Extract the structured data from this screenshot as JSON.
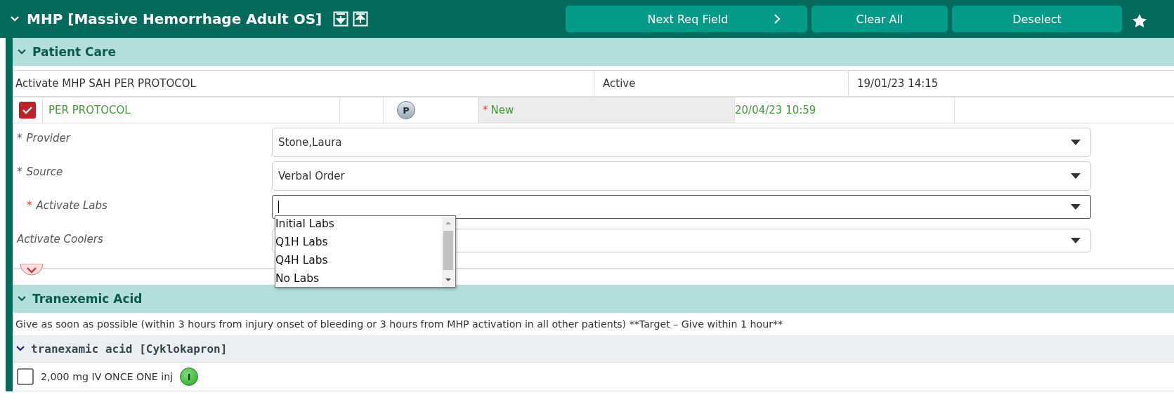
{
  "order_set": {
    "title": "MHP [Massive Hemorrhage Adult OS]",
    "expanded": true,
    "buttons": [
      {
        "label": "Next Req Field",
        "kind": "next"
      },
      {
        "label": "Clear All",
        "kind": "plain"
      },
      {
        "label": "Deselect",
        "kind": "plain"
      }
    ]
  },
  "patient_care": {
    "title": "Patient Care",
    "expanded": true,
    "active_order": {
      "cells": [
        "Activate MHP SAH PER PROTOCOL",
        "Active",
        "19/01/23 14:15"
      ]
    },
    "new_order": {
      "checked": true,
      "name": "PER PROTOCOL",
      "badge": "P",
      "status_marker": "*",
      "status": "New",
      "date": "20/04/23 10:59"
    },
    "details": [
      {
        "marker": "*",
        "label": "Provider",
        "alert": false,
        "value": "Stone,Laura",
        "focused": false
      },
      {
        "marker": "*",
        "label": "Source",
        "alert": false,
        "value": "Verbal Order",
        "focused": false
      },
      {
        "marker": "*",
        "label": "Activate Labs",
        "alert": true,
        "focused": true,
        "open": true,
        "options": [
          "Initial Labs",
          "Q1H Labs",
          "Q4H Labs",
          "No Labs"
        ]
      },
      {
        "label": "Activate Coolers",
        "focused": false
      }
    ]
  },
  "tranexemic_acid": {
    "title": "Tranexemic Acid",
    "expanded": true,
    "note": "Give as soon as possible (within 3 hours from injury onset of bleeding or 3 hours from MHP activation in all other patients) **Target – Give within 1 hour**",
    "medication": {
      "title": "tranexamic acid [Cyklokapron]",
      "expanded": true,
      "orders": [
        {
          "checked": false,
          "text": "2,000 mg IV ONCE ONE inj",
          "badge": "I"
        }
      ]
    }
  }
}
